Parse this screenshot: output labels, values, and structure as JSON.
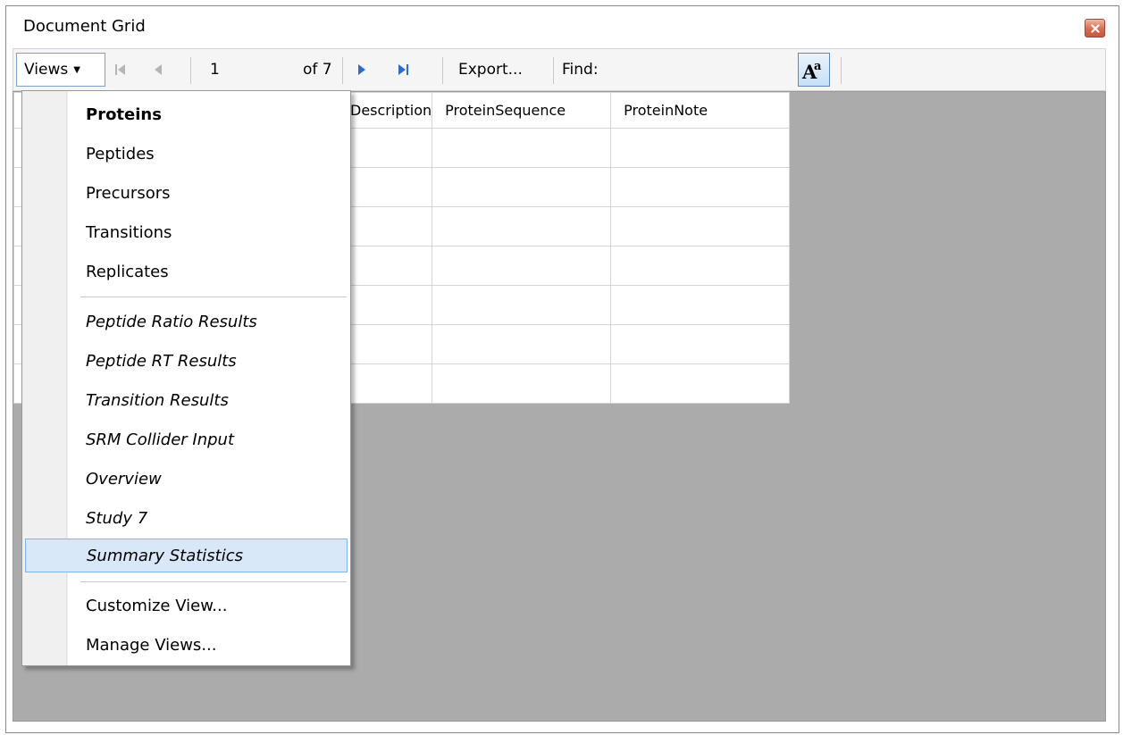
{
  "window": {
    "title": "Document Grid",
    "close_icon": "close-icon"
  },
  "toolbar": {
    "views_label": "Views",
    "page_value": "1",
    "page_of": "of 7",
    "export_label": "Export...",
    "find_label": "Find:",
    "find_value": ""
  },
  "grid": {
    "columns": [
      "Description",
      "ProteinSequence",
      "ProteinNote"
    ],
    "row_count": 7
  },
  "menu": {
    "items": [
      "Proteins",
      "Peptides",
      "Precursors",
      "Transitions",
      "Replicates",
      "Peptide Ratio Results",
      "Peptide RT Results",
      "Transition Results",
      "SRM Collider Input",
      "Overview",
      "Study 7",
      "Summary Statistics",
      "Customize View...",
      "Manage Views..."
    ],
    "selected": "Summary Statistics"
  },
  "colors": {
    "highlight": "#d8e8f8",
    "highlight_border": "#7eb4ea",
    "grid_background": "#ababab",
    "nav_blue": "#2d6bcf"
  }
}
